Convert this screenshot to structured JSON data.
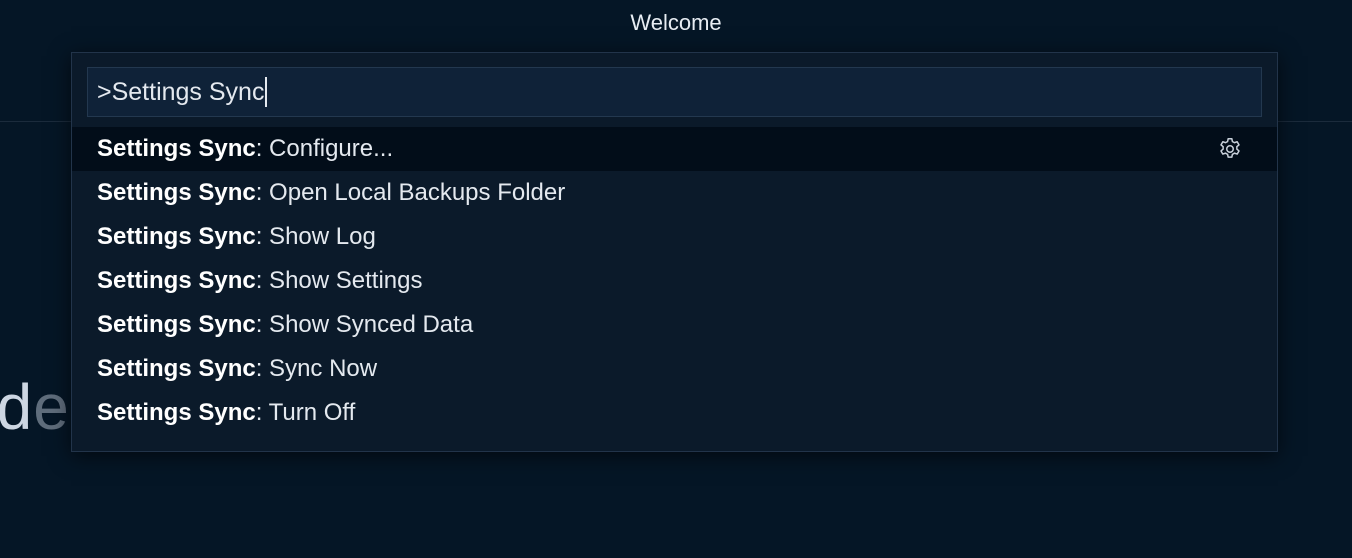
{
  "window": {
    "title": "Welcome"
  },
  "background": {
    "heading_visible": "od",
    "heading_faded": "e"
  },
  "palette": {
    "input_value": ">Settings Sync",
    "results": [
      {
        "match": "Settings Sync",
        "rest": ": Configure...",
        "active": true,
        "action_icon": "gear-icon"
      },
      {
        "match": "Settings Sync",
        "rest": ": Open Local Backups Folder",
        "active": false
      },
      {
        "match": "Settings Sync",
        "rest": ": Show Log",
        "active": false
      },
      {
        "match": "Settings Sync",
        "rest": ": Show Settings",
        "active": false
      },
      {
        "match": "Settings Sync",
        "rest": ": Show Synced Data",
        "active": false
      },
      {
        "match": "Settings Sync",
        "rest": ": Sync Now",
        "active": false
      },
      {
        "match": "Settings Sync",
        "rest": ": Turn Off",
        "active": false
      }
    ]
  },
  "colors": {
    "background": "#051626",
    "palette_bg": "#0b1a2a",
    "input_bg": "#0f2238",
    "active_row_bg": "#020d19",
    "text": "#e4e9ef"
  }
}
